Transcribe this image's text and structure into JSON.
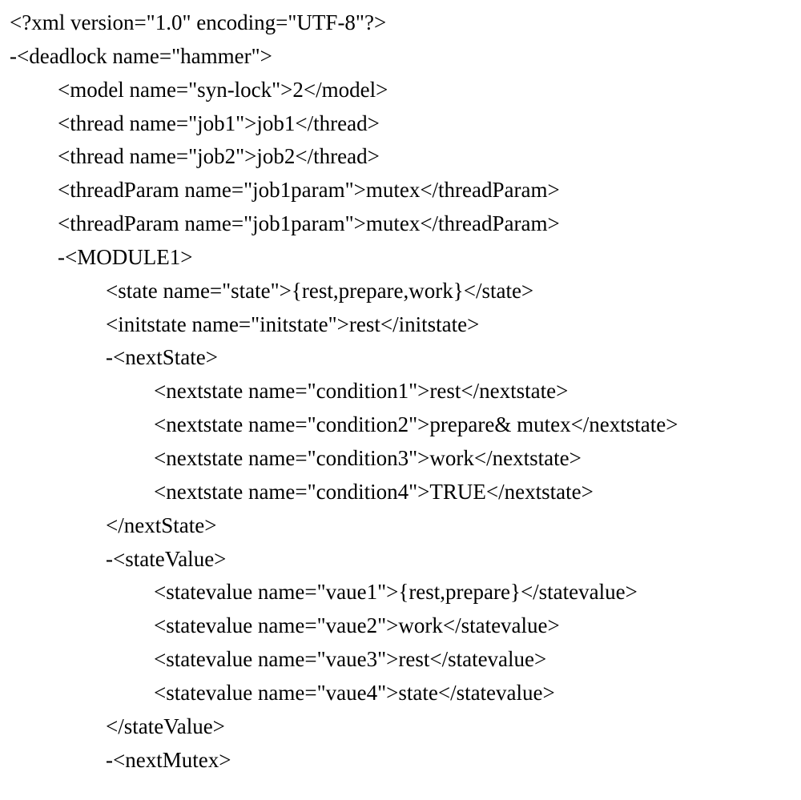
{
  "lines": [
    {
      "indent": 0,
      "text": "<?xml version=\"1.0\" encoding=\"UTF-8\"?>"
    },
    {
      "indent": 0,
      "text": "-<deadlock name=\"hammer\">"
    },
    {
      "indent": 1,
      "text": "<model name=\"syn-lock\">2</model>"
    },
    {
      "indent": 1,
      "text": "<thread name=\"job1\">job1</thread>"
    },
    {
      "indent": 1,
      "text": "<thread name=\"job2\">job2</thread>"
    },
    {
      "indent": 1,
      "text": "<threadParam name=\"job1param\">mutex</threadParam>"
    },
    {
      "indent": 1,
      "text": "<threadParam name=\"job1param\">mutex</threadParam>"
    },
    {
      "indent": 1,
      "text": "-<MODULE1>"
    },
    {
      "indent": 2,
      "text": "<state name=\"state\">{rest,prepare,work}</state>"
    },
    {
      "indent": 2,
      "text": "<initstate name=\"initstate\">rest</initstate>"
    },
    {
      "indent": 2,
      "text": "-<nextState>"
    },
    {
      "indent": 3,
      "text": "<nextstate name=\"condition1\">rest</nextstate>"
    },
    {
      "indent": 3,
      "text": "<nextstate name=\"condition2\">prepare& mutex</nextstate>"
    },
    {
      "indent": 3,
      "text": "<nextstate name=\"condition3\">work</nextstate>"
    },
    {
      "indent": 3,
      "text": "<nextstate name=\"condition4\">TRUE</nextstate>"
    },
    {
      "indent": 2,
      "text": "</nextState>"
    },
    {
      "indent": 2,
      "text": "-<stateValue>"
    },
    {
      "indent": 3,
      "text": "<statevalue name=\"vaue1\">{rest,prepare}</statevalue>"
    },
    {
      "indent": 3,
      "text": "<statevalue name=\"vaue2\">work</statevalue>"
    },
    {
      "indent": 3,
      "text": "<statevalue name=\"vaue3\">rest</statevalue>"
    },
    {
      "indent": 3,
      "text": "<statevalue name=\"vaue4\">state</statevalue>"
    },
    {
      "indent": 2,
      "text": "</stateValue>"
    },
    {
      "indent": 2,
      "text": "-<nextMutex>"
    }
  ]
}
